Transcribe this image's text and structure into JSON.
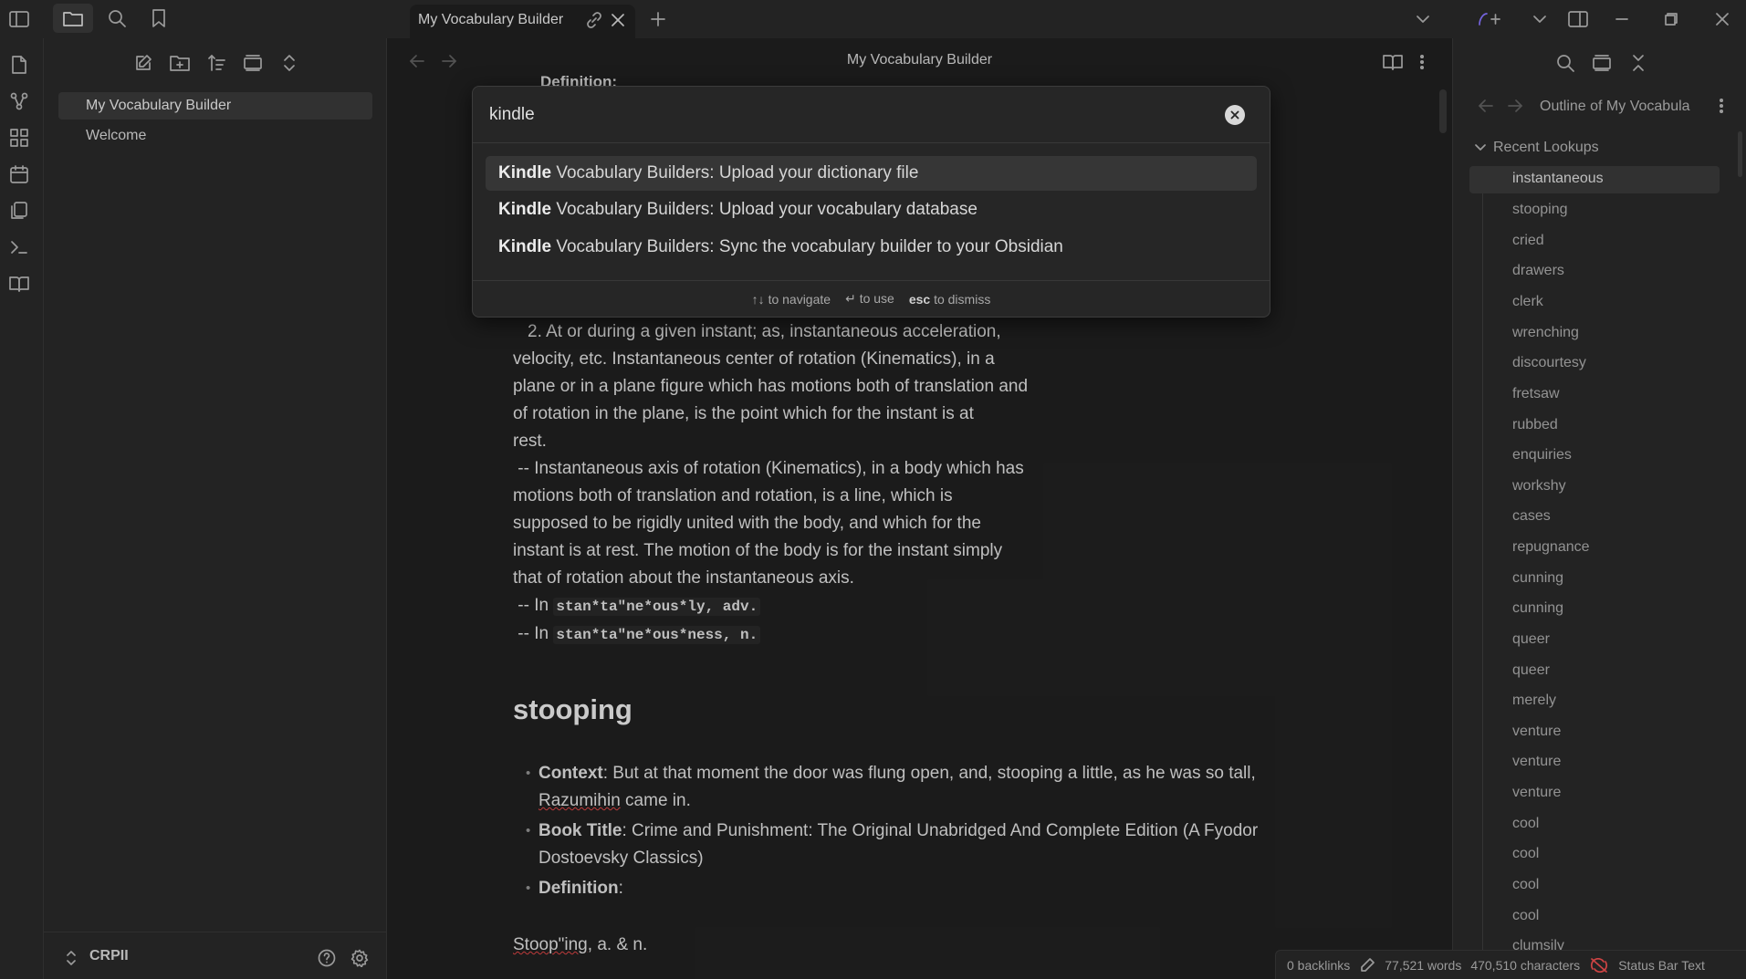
{
  "app": {
    "tab_title": "My Vocabulary Builder",
    "view_title": "My Vocabulary Builder",
    "accent": "#7f6df2"
  },
  "file_explorer": {
    "files": [
      "My Vocabulary Builder",
      "Welcome"
    ],
    "vault_name": "CRPII"
  },
  "editor": {
    "partial_top": "Definition:",
    "paragraph_lines": [
      "2. At or during a given instant; as, instantaneous acceleration,",
      "velocity, etc. Instantaneous center of rotation (Kinematics), in a",
      "plane or in a plane figure which has motions both of translation and",
      "of rotation in the plane, is the point which for the instant is at",
      "rest.",
      " -- Instantaneous axis of rotation (Kinematics), in a body which has",
      "motions both of translation and rotation, is a line, which is",
      "supposed to be rigidly united with the body, and which for the",
      "instant is at rest. The motion of the body is for the instant simply",
      "that of rotation about the instantaneous axis."
    ],
    "derived": [
      {
        "prefix": " -- In",
        "code": "stan*ta\"ne*ous*ly, adv."
      },
      {
        "prefix": " -- In",
        "code": "stan*ta\"ne*ous*ness, n."
      }
    ],
    "heading": "stooping",
    "context_label": "Context",
    "context_text_1": ": But at that moment the door was flung open, and, stooping a little, as he was so tall,",
    "context_text_2a": "Razumihin",
    "context_text_2b": " came in.",
    "book_label": "Book Title",
    "book_text_1": ": Crime and Punishment: The Original Unabridged And Complete Edition (A Fyodor",
    "book_text_2": "Dostoevsky Classics)",
    "definition_label": "Definition",
    "definition_suffix": ":",
    "entry_a": "Stoop\"ing",
    "entry_b": ", a. & n."
  },
  "command_palette": {
    "query": "kindle",
    "suggestions": [
      {
        "bold": "Kindle",
        "rest": " Vocabulary Builders: Upload your dictionary file"
      },
      {
        "bold": "Kindle",
        "rest": " Vocabulary Builders: Upload your vocabulary database"
      },
      {
        "bold": "Kindle",
        "rest": " Vocabulary Builders: Sync the vocabulary builder to your Obsidian"
      }
    ],
    "hint_navigate_key": "↑↓",
    "hint_navigate": "to navigate",
    "hint_use_key": "↵",
    "hint_use": "to use",
    "hint_dismiss_key": "esc",
    "hint_dismiss": "to dismiss"
  },
  "outline": {
    "title": "Outline of My Vocabula",
    "section": "Recent Lookups",
    "items": [
      "instantaneous",
      "stooping",
      "cried",
      "drawers",
      "clerk",
      "wrenching",
      "discourtesy",
      "fretsaw",
      "rubbed",
      "enquiries",
      "workshy",
      "cases",
      "repugnance",
      "cunning",
      "cunning",
      "queer",
      "queer",
      "merely",
      "venture",
      "venture",
      "venture",
      "cool",
      "cool",
      "cool",
      "cool",
      "clumsily"
    ]
  },
  "status_bar": {
    "backlinks": "0 backlinks",
    "words": "77,521 words",
    "characters": "470,510 characters",
    "extra": "Status Bar Text"
  }
}
